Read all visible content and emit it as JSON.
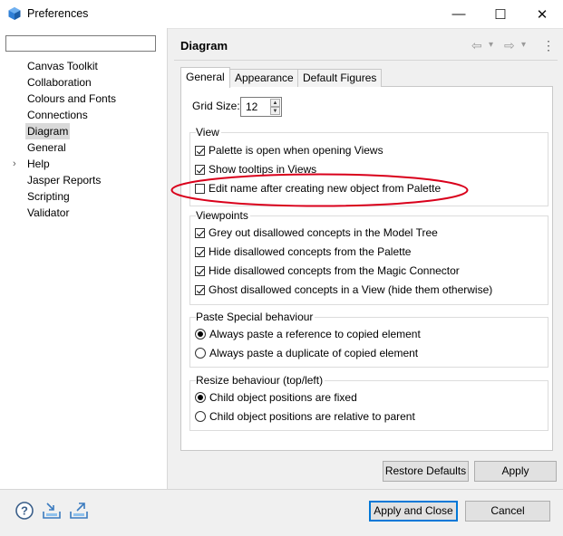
{
  "window": {
    "title": "Preferences",
    "minimize": "—",
    "maximize": "☐",
    "close": "✕"
  },
  "sidebar": {
    "filter_value": "",
    "items": [
      {
        "label": "Canvas Toolkit"
      },
      {
        "label": "Collaboration"
      },
      {
        "label": "Colours and Fonts"
      },
      {
        "label": "Connections"
      },
      {
        "label": "Diagram"
      },
      {
        "label": "General"
      },
      {
        "label": "Help",
        "expander": "›"
      },
      {
        "label": "Jasper Reports"
      },
      {
        "label": "Scripting"
      },
      {
        "label": "Validator"
      }
    ]
  },
  "page": {
    "title": "Diagram",
    "nav": {
      "back": "⇦",
      "forward": "⇨",
      "dropdown": "▾",
      "menu": "⋮"
    }
  },
  "tabs": [
    {
      "label": "General",
      "active": true
    },
    {
      "label": "Appearance"
    },
    {
      "label": "Default Figures"
    }
  ],
  "general": {
    "grid_size_label": "Grid Size:",
    "grid_size_value": "12",
    "view": {
      "title": "View",
      "options": [
        {
          "label": "Palette is open when opening Views",
          "checked": true
        },
        {
          "label": "Show tooltips in Views",
          "checked": true
        },
        {
          "label": "Edit name after creating new object from Palette",
          "checked": false
        }
      ]
    },
    "viewpoints": {
      "title": "Viewpoints",
      "options": [
        {
          "label": "Grey out disallowed concepts in the Model Tree",
          "checked": true
        },
        {
          "label": "Hide disallowed concepts from the Palette",
          "checked": true
        },
        {
          "label": "Hide disallowed concepts from the Magic Connector",
          "checked": true
        },
        {
          "label": "Ghost disallowed concepts in a View (hide them otherwise)",
          "checked": true
        }
      ]
    },
    "paste": {
      "title": "Paste Special behaviour",
      "options": [
        {
          "label": "Always paste a reference to copied element",
          "selected": true
        },
        {
          "label": "Always paste a duplicate of copied element",
          "selected": false
        }
      ]
    },
    "resize": {
      "title": "Resize behaviour (top/left)",
      "options": [
        {
          "label": "Child object positions are fixed",
          "selected": true
        },
        {
          "label": "Child object positions are relative to parent",
          "selected": false
        }
      ]
    }
  },
  "buttons": {
    "restore_defaults": "Restore Defaults",
    "apply": "Apply",
    "apply_and_close": "Apply and Close",
    "cancel": "Cancel"
  },
  "bottom_icons": [
    "help-icon",
    "import-icon",
    "export-icon"
  ],
  "colors": {
    "annotation": "#d9001b",
    "accent": "#0078d7",
    "app_icon": "#2f7fd6"
  }
}
